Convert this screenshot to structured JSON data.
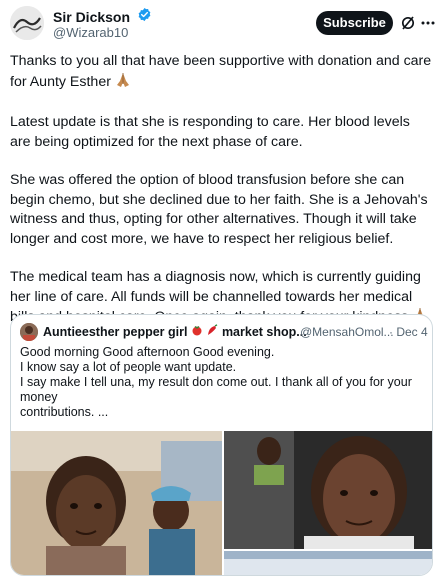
{
  "author": {
    "display_name": "Sir Dickson",
    "handle": "@Wizarab10",
    "verified": true
  },
  "header": {
    "subscribe_label": "Subscribe",
    "icons": [
      "grok-icon",
      "more-icon"
    ]
  },
  "post": {
    "paragraphs": [
      "Thanks to you all that have been supportive with donation and care for Aunty Esther",
      "Latest update is that she is responding to care. Her blood levels are being optimized for the next phase of care.",
      "She was offered the option of blood transfusion before she can begin chemo, but she declined due to her faith. She is a Jehovah's witness and thus, opting for other alternatives. Though it will take longer and cost more, we have to respect her religious belief.",
      "The medical team has a diagnosis now, which is currently guiding her line of care. All funds will be channelled towards her medical bills and hospital care. Once again, thank you for your kindness"
    ],
    "emoji": "praying-hands"
  },
  "quote": {
    "display_name": "Auntieesther pepper girl",
    "name_suffix": "market shop...",
    "handle": "@MensahOmol...",
    "date_sep": "·",
    "date": "Dec 4",
    "lines": [
      "Good morning Good afternoon Good evening.",
      "I know say a lot of people want update.",
      "",
      "I say make I tell una, my result don come out. I thank all of you for your money",
      "contributions. ..."
    ]
  },
  "colors": {
    "text": "#0f1419",
    "secondary": "#536471",
    "verified": "#1d9bf0",
    "border": "#cfd9de"
  }
}
